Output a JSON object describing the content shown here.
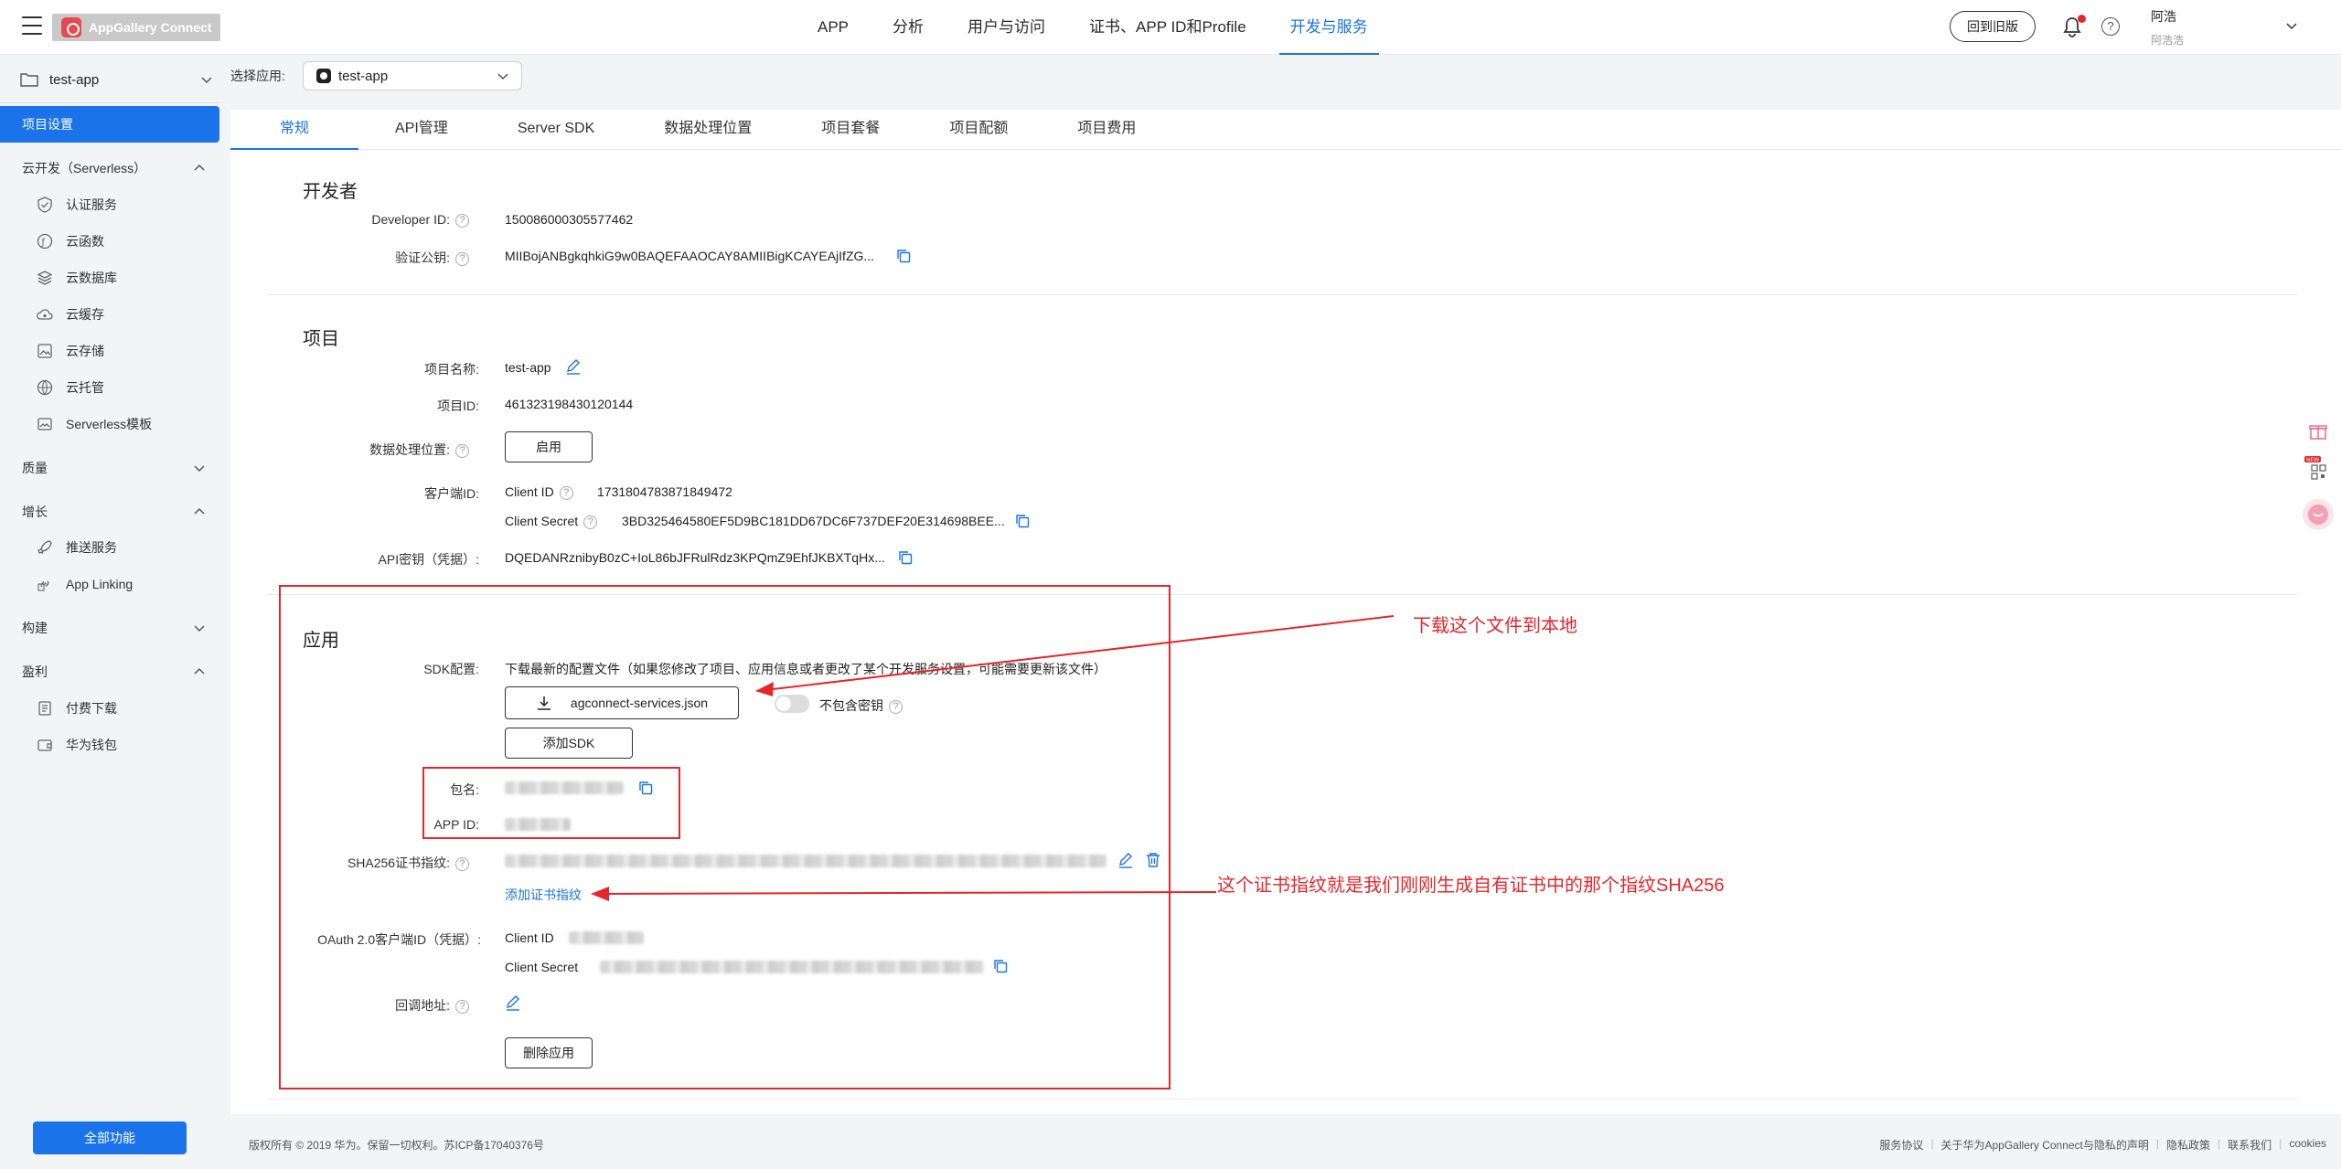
{
  "topbar": {
    "brand": "AppGallery Connect",
    "nav": [
      "APP",
      "分析",
      "用户与访问",
      "证书、APP ID和Profile",
      "开发与服务"
    ],
    "active_nav": "开发与服务",
    "old_version_label": "回到旧版",
    "help_glyph": "?",
    "user_name": "阿浩",
    "user_sub": "阿浩浩"
  },
  "sidebar": {
    "project": "test-app",
    "active_item": "项目设置",
    "groups": [
      {
        "label": "云开发（Serverless）",
        "expanded": true,
        "items": [
          "认证服务",
          "云函数",
          "云数据库",
          "云缓存",
          "云存储",
          "云托管",
          "Serverless模板"
        ]
      },
      {
        "label": "质量",
        "expanded": false,
        "items": []
      },
      {
        "label": "增长",
        "expanded": true,
        "items": [
          "推送服务",
          "App Linking"
        ]
      },
      {
        "label": "构建",
        "expanded": false,
        "items": []
      },
      {
        "label": "盈利",
        "expanded": true,
        "items": [
          "付费下载",
          "华为钱包"
        ]
      }
    ],
    "all_features": "全部功能"
  },
  "app_selector": {
    "label": "选择应用:",
    "value": "test-app"
  },
  "tabs": [
    "常规",
    "API管理",
    "Server SDK",
    "数据处理位置",
    "项目套餐",
    "项目配额",
    "项目费用"
  ],
  "developer": {
    "title": "开发者",
    "developer_id_label": "Developer ID:",
    "developer_id": "150086000305577462",
    "public_key_label": "验证公钥:",
    "public_key": "MIIBojANBgkqhkiG9w0BAQEFAAOCAY8AMIIBigKCAYEAjIfZG..."
  },
  "project": {
    "title": "项目",
    "name_label": "项目名称:",
    "name": "test-app",
    "id_label": "项目ID:",
    "id": "461323198430120144",
    "data_location_label": "数据处理位置:",
    "enable_button": "启用",
    "client_id_label": "客户端ID:",
    "client_id_key": "Client ID",
    "client_id": "1731804783871849472",
    "client_secret_key": "Client Secret",
    "client_secret": "3BD325464580EF5D9BC181DD67DC6F737DEF20E314698BEE...",
    "api_key_label": "API密钥（凭据）:",
    "api_key": "DQEDANRznibyB0zC+IoL86bJFRulRdz3KPQmZ9EhfJKBXTqHx..."
  },
  "application": {
    "title": "应用",
    "sdk_label": "SDK配置:",
    "sdk_desc": "下载最新的配置文件（如果您修改了项目、应用信息或者更改了某个开发服务设置，可能需要更新该文件）",
    "download_file": "agconnect-services.json",
    "exclude_key_label": "不包含密钥",
    "add_sdk": "添加SDK",
    "package_label": "包名:",
    "app_id_label": "APP ID:",
    "sha256_label": "SHA256证书指纹:",
    "add_fingerprint": "添加证书指纹",
    "oauth_label": "OAuth 2.0客户端ID（凭据）:",
    "oauth_client_id_key": "Client ID",
    "oauth_client_secret_key": "Client Secret",
    "callback_label": "回调地址:",
    "delete_app": "删除应用"
  },
  "annotations": {
    "download_note": "下载这个文件到本地",
    "fingerprint_note": "这个证书指纹就是我们刚刚生成自有证书中的那个指纹SHA256"
  },
  "footer": {
    "copyright": "版权所有 © 2019 华为。保留一切权利。苏ICP备17040376号",
    "links": [
      "服务协议",
      "关于华为AppGallery Connect与隐私的声明",
      "隐私政策",
      "联系我们",
      "cookies"
    ]
  },
  "colors": {
    "accent": "#1a73e8",
    "annotation_red": "#e5262b"
  }
}
